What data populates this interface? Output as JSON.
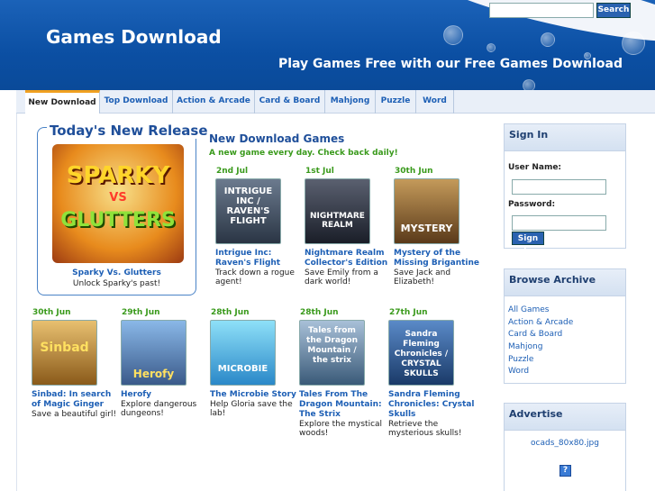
{
  "header": {
    "site_title": "Games Download",
    "tagline": "Play Games Free with our Free Games Download",
    "search_button": "Search"
  },
  "nav": {
    "tabs": [
      {
        "label": "New Download"
      },
      {
        "label": "Top Download"
      },
      {
        "label": "Action & Arcade"
      },
      {
        "label": "Card & Board"
      },
      {
        "label": "Mahjong"
      },
      {
        "label": "Puzzle"
      },
      {
        "label": "Word"
      }
    ]
  },
  "release": {
    "title": "Today's New Release",
    "image_text": [
      "SPARKY",
      "VS",
      "GLUTTERS"
    ],
    "name": "Sparky Vs. Glutters",
    "desc": "Unlock Sparky's past!"
  },
  "main": {
    "heading": "New Download Games",
    "subheading": "A new game every day. Check back daily!",
    "games": [
      {
        "date": "2nd Jul",
        "name": "Intrigue Inc: Raven's Flight",
        "desc": "Track down a rogue agent!",
        "thumb": "INTRIGUE INC / RAVEN'S FLIGHT",
        "color": "#3a4a5e"
      },
      {
        "date": "1st Jul",
        "name": "Nightmare Realm Collector's Edition",
        "desc": "Save Emily from a dark world!",
        "thumb": "NIGHTMARE REALM",
        "color": "#2a2f3a"
      },
      {
        "date": "30th Jun",
        "name": "Mystery of the Missing Brigantine",
        "desc": "Save Jack and Elizabeth!",
        "thumb": "MYSTERY",
        "color": "#7a5a2e"
      },
      {
        "date": "30th Jun",
        "name": "Sinbad: In search of Magic Ginger",
        "desc": "Save a beautiful girl!",
        "thumb": "Sinbad",
        "color": "#b88a2a"
      },
      {
        "date": "29th Jun",
        "name": "Herofy",
        "desc": "Explore dangerous dungeons!",
        "thumb": "Herofy",
        "color": "#4a7ab8"
      },
      {
        "date": "28th Jun",
        "name": "The Microbie Story",
        "desc": "Help Gloria save the lab!",
        "thumb": "MICROBIE",
        "color": "#3aa8d8"
      },
      {
        "date": "28th Jun",
        "name": "Tales From The Dragon Mountain: The Strix",
        "desc": "Explore the mystical woods!",
        "thumb": "Tales from the Dragon Mountain / the strix",
        "color": "#5a7a9a"
      },
      {
        "date": "27th Jun",
        "name": "Sandra Fleming Chronicles: Crystal Skulls",
        "desc": "Retrieve the mysterious skulls!",
        "thumb": "Sandra Fleming Chronicles / CRYSTAL SKULLS",
        "color": "#2a5a8a"
      }
    ]
  },
  "signin": {
    "title": "Sign In",
    "username_label": "User Name:",
    "password_label": "Password:",
    "button": "Sign In"
  },
  "archive": {
    "title": "Browse Archive",
    "links": [
      "All Games",
      "Action & Arcade",
      "Card & Board",
      "Mahjong",
      "Puzzle",
      "Word"
    ]
  },
  "advertise": {
    "title": "Advertise",
    "image_alt": "ocads_80x80.jpg",
    "icon_text": "?"
  }
}
